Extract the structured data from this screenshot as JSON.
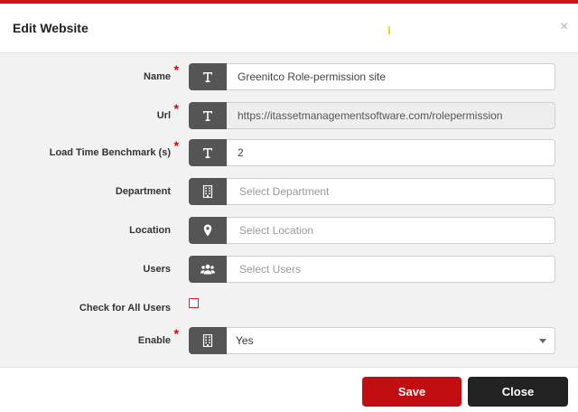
{
  "modal": {
    "title": "Edit Website",
    "close_glyph": "×"
  },
  "form": {
    "name": {
      "label": "Name",
      "value": "Greenitco Role-permission site",
      "required": true,
      "icon": "text-icon"
    },
    "url": {
      "label": "Url",
      "value": "https://itassetmanagementsoftware.com/rolepermission",
      "required": true,
      "icon": "text-icon"
    },
    "benchmark": {
      "label": "Load Time Benchmark (s)",
      "value": "2",
      "required": true,
      "icon": "text-icon"
    },
    "department": {
      "label": "Department",
      "placeholder": "Select Department",
      "icon": "building-icon"
    },
    "location": {
      "label": "Location",
      "placeholder": "Select Location",
      "icon": "map-marker-icon"
    },
    "users": {
      "label": "Users",
      "placeholder": "Select Users",
      "icon": "users-icon"
    },
    "check_all_users": {
      "label": "Check for All Users",
      "checked": false
    },
    "enable": {
      "label": "Enable",
      "value": "Yes",
      "required": true,
      "icon": "building-icon"
    }
  },
  "footer": {
    "save_label": "Save",
    "close_label": "Close"
  },
  "colors": {
    "accent_red": "#c20d11",
    "addon_gray": "#555555",
    "close_button": "#222222",
    "required_star": "#e00000"
  }
}
